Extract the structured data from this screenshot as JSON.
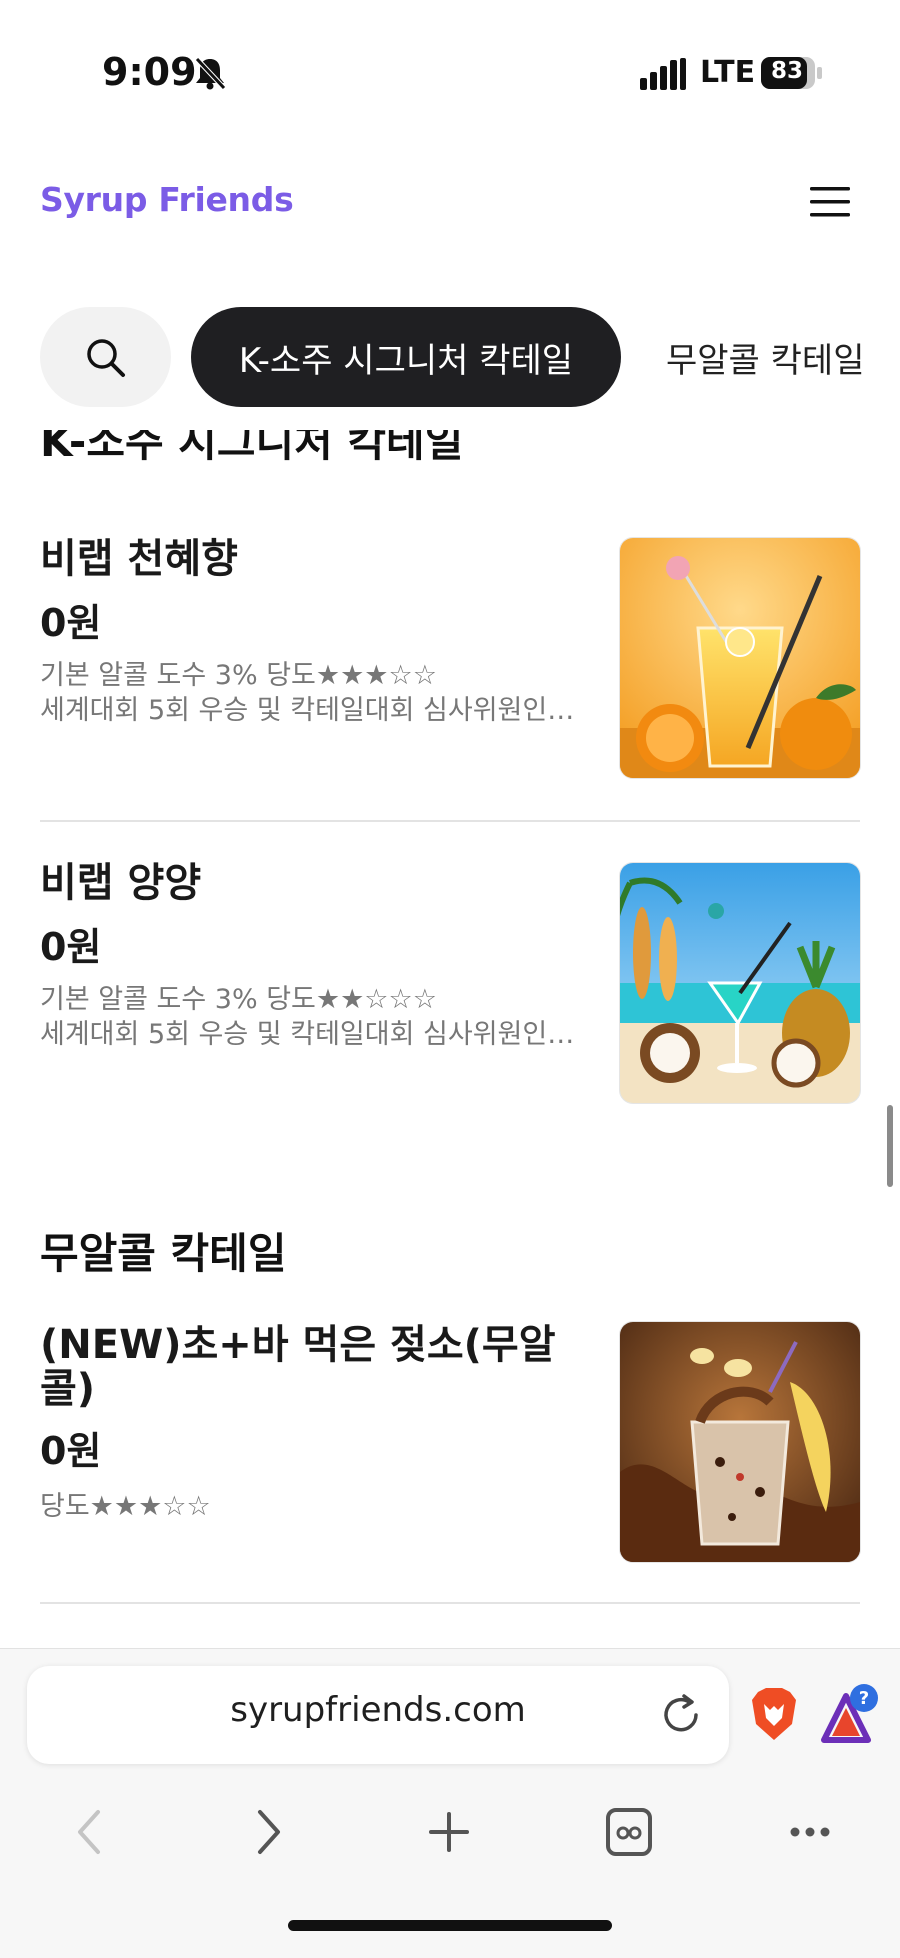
{
  "status_bar": {
    "time": "9:09",
    "network": "LTE",
    "battery": "83"
  },
  "header": {
    "brand": "Syrup Friends"
  },
  "tabs": {
    "active": "K-소주 시그니처 칵테일",
    "next": "무알콜 칵테일"
  },
  "sections": [
    {
      "title": "K-소주 시그니처 칵테일",
      "items": [
        {
          "name": "비랩 천혜향",
          "price": "0원",
          "desc1": "기본 알콜 도수 3% 당도★★★☆☆",
          "desc2": "세계대회 5회 우승 및 칵테일대회 심사위원인 ..."
        },
        {
          "name": "비랩 양양",
          "price": "0원",
          "desc1": "기본 알콜 도수 3%  당도★★☆☆☆",
          "desc2": "세계대회 5회 우승 및 칵테일대회 심사위원인 ..."
        }
      ]
    },
    {
      "title": "무알콜 칵테일",
      "items": [
        {
          "name_line1": "(NEW)초+바 먹은 젖소(무알",
          "name_line2": "콜)",
          "price": "0원",
          "desc1": "당도★★★☆☆"
        }
      ]
    }
  ],
  "browser": {
    "url": "syrupfriends.com",
    "rewards_badge": "?"
  },
  "colors": {
    "brand": "#7b5ce6",
    "active_tab": "#1f1f22",
    "text_muted": "#777777"
  },
  "icons": [
    "bell-off-icon",
    "signal-icon",
    "battery-icon",
    "hamburger-icon",
    "search-icon",
    "reload-icon",
    "brave-lion-icon",
    "rewards-triangle-icon",
    "back-icon",
    "forward-icon",
    "new-tab-icon",
    "tabs-icon",
    "more-icon"
  ]
}
